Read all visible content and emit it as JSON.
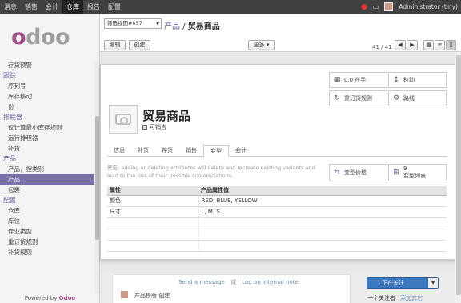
{
  "topbar": {
    "menus": [
      "消息",
      "销售",
      "会计",
      "仓库",
      "报告",
      "配置"
    ],
    "active_index": 3,
    "user": "Administrator (tiny)"
  },
  "sidebar": {
    "logo": "odoo",
    "powered_by": "Powered by",
    "powered_brand": "Odoo",
    "items": [
      {
        "type": "item",
        "label": "存货预警"
      },
      {
        "type": "section",
        "label": "跟踪"
      },
      {
        "type": "item",
        "label": "序列号"
      },
      {
        "type": "item",
        "label": "库存移动"
      },
      {
        "type": "item",
        "label": "份"
      },
      {
        "type": "section",
        "label": "排程器"
      },
      {
        "type": "item",
        "label": "仅计算最小库存规则"
      },
      {
        "type": "item",
        "label": "运行排程器"
      },
      {
        "type": "item",
        "label": "补货"
      },
      {
        "type": "section",
        "label": "产品"
      },
      {
        "type": "item",
        "label": "产品，按类别"
      },
      {
        "type": "item",
        "label": "产品",
        "active": true
      },
      {
        "type": "item",
        "label": "包裹"
      },
      {
        "type": "section",
        "label": "配置"
      },
      {
        "type": "item",
        "label": "仓库"
      },
      {
        "type": "item",
        "label": "库位"
      },
      {
        "type": "item",
        "label": "作业类型"
      },
      {
        "type": "item",
        "label": "重订货规则"
      },
      {
        "type": "item",
        "label": "补货规则"
      }
    ]
  },
  "header": {
    "search_value": "筛选视图#057",
    "breadcrumb_parent": "产品",
    "breadcrumb_sep": " / ",
    "breadcrumb_current": "贸易商品",
    "edit_label": "编辑",
    "create_label": "创建",
    "more_label": "更多 ▾",
    "pager": "41 / 41"
  },
  "form": {
    "title": "贸易商品",
    "can_be_sold": "可销售",
    "stat_buttons": [
      {
        "icon": "building-icon",
        "glyph": "▦",
        "label": "0.0 在手"
      },
      {
        "icon": "arrows-vertical-icon",
        "glyph": "↕",
        "label": "移动"
      },
      {
        "icon": "refresh-icon",
        "glyph": "↻",
        "label": "重订货规则"
      },
      {
        "icon": "cogs-icon",
        "glyph": "⚙",
        "label": "路线"
      }
    ],
    "tabs": [
      "信息",
      "补货",
      "存货",
      "销售",
      "变型",
      "会计"
    ],
    "active_tab": 4,
    "warning": "警告: adding or deleting attributes will delete and recreate existing variants and lead to the loss of their possible customizations.",
    "variant_prices": "变型价格",
    "variant_count": "9",
    "variant_list": "变型列表",
    "table": {
      "headers": [
        "属性",
        "产品属性值"
      ],
      "rows": [
        [
          "颜色",
          "RED, BLUE, YELLOW"
        ],
        [
          "尺寸",
          "L, M, S"
        ]
      ]
    }
  },
  "chatter": {
    "send_message": "Send a message",
    "or": "或",
    "log_note": "Log an internal note",
    "message": "产品模版 创建",
    "follow_label": "正在关注",
    "followers": "一个关注者",
    "add_others": "添加其它"
  }
}
